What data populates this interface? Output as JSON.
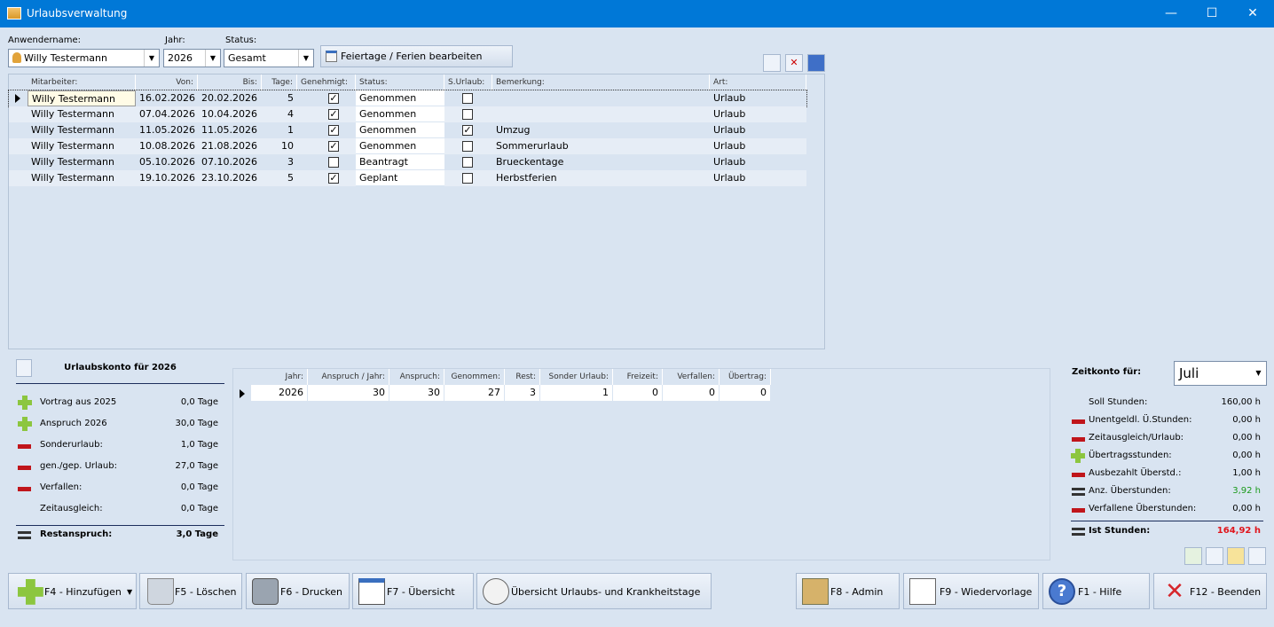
{
  "window": {
    "title": "Urlaubsverwaltung",
    "min": "—",
    "max": "☐",
    "close": "✕"
  },
  "filters": {
    "user_label": "Anwendername:",
    "user_value": "Willy Testermann",
    "year_label": "Jahr:",
    "year_value": "2026",
    "status_label": "Status:",
    "status_value": "Gesamt",
    "holiday_button": "Feiertage / Ferien bearbeiten"
  },
  "grid": {
    "headers": [
      "Mitarbeiter:",
      "Von:",
      "Bis:",
      "Tage:",
      "Genehmigt:",
      "Status:",
      "S.Urlaub:",
      "Bemerkung:",
      "Art:"
    ],
    "rows": [
      {
        "name": "Willy Testermann",
        "von": "16.02.2026",
        "bis": "20.02.2026",
        "tage": "5",
        "gen": true,
        "status": "Genommen",
        "surl": false,
        "bem": "",
        "art": "Urlaub"
      },
      {
        "name": "Willy Testermann",
        "von": "07.04.2026",
        "bis": "10.04.2026",
        "tage": "4",
        "gen": true,
        "status": "Genommen",
        "surl": false,
        "bem": "",
        "art": "Urlaub"
      },
      {
        "name": "Willy Testermann",
        "von": "11.05.2026",
        "bis": "11.05.2026",
        "tage": "1",
        "gen": true,
        "status": "Genommen",
        "surl": true,
        "bem": "Umzug",
        "art": "Urlaub"
      },
      {
        "name": "Willy Testermann",
        "von": "10.08.2026",
        "bis": "21.08.2026",
        "tage": "10",
        "gen": true,
        "status": "Genommen",
        "surl": false,
        "bem": "Sommerurlaub",
        "art": "Urlaub"
      },
      {
        "name": "Willy Testermann",
        "von": "05.10.2026",
        "bis": "07.10.2026",
        "tage": "3",
        "gen": false,
        "status": "Beantragt",
        "surl": false,
        "bem": "Brueckentage",
        "art": "Urlaub"
      },
      {
        "name": "Willy Testermann",
        "von": "19.10.2026",
        "bis": "23.10.2026",
        "tage": "5",
        "gen": true,
        "status": "Geplant",
        "surl": false,
        "bem": "Herbstferien",
        "art": "Urlaub"
      }
    ]
  },
  "konto": {
    "title": "Urlaubskonto für 2026",
    "rows": [
      {
        "label": "Vortrag aus 2025",
        "value": "0,0 Tage",
        "icon": "plus"
      },
      {
        "label": "Anspruch 2026",
        "value": "30,0 Tage",
        "icon": "plus"
      },
      {
        "label": "Sonderurlaub:",
        "value": "1,0 Tage",
        "icon": "minus"
      },
      {
        "label": "gen./gep. Urlaub:",
        "value": "27,0 Tage",
        "icon": "minus"
      },
      {
        "label": "Verfallen:",
        "value": "0,0 Tage",
        "icon": "minus"
      },
      {
        "label": "Zeitausgleich:",
        "value": "0,0 Tage",
        "icon": "none"
      }
    ],
    "total_label": "Restanspruch:",
    "total_value": "3,0 Tage"
  },
  "summary": {
    "headers": [
      "Jahr:",
      "Anspruch / Jahr:",
      "Anspruch:",
      "Genommen:",
      "Rest:",
      "Sonder Urlaub:",
      "Freizeit:",
      "Verfallen:",
      "Übertrag:"
    ],
    "row": [
      "2026",
      "30",
      "30",
      "27",
      "3",
      "1",
      "0",
      "0",
      "0"
    ]
  },
  "zeitkonto": {
    "label": "Zeitkonto für:",
    "month": "Juli",
    "rows": [
      {
        "label": "Soll Stunden:",
        "value": "160,00 h",
        "icon": "none",
        "color": "#000000"
      },
      {
        "label": "Unentgeldl. Ü.Stunden:",
        "value": "0,00 h",
        "icon": "minus",
        "color": "#000000"
      },
      {
        "label": "Zeitausgleich/Urlaub:",
        "value": "0,00 h",
        "icon": "minus",
        "color": "#000000"
      },
      {
        "label": "Übertragsstunden:",
        "value": "0,00 h",
        "icon": "plus",
        "color": "#000000"
      },
      {
        "label": "Ausbezahlt Überstd.:",
        "value": "1,00 h",
        "icon": "minus",
        "color": "#000000"
      },
      {
        "label": "Anz. Überstunden:",
        "value": "3,92 h",
        "icon": "eq",
        "color": "#1a9a1a"
      },
      {
        "label": "Verfallene Überstunden:",
        "value": "0,00 h",
        "icon": "minus",
        "color": "#000000"
      }
    ],
    "total_label": "Ist Stunden:",
    "total_value": "164,92 h",
    "total_color": "#e0141b"
  },
  "footer": {
    "add": "F4 - Hinzufügen",
    "delete": "F5 - Löschen",
    "print": "F6 - Drucken",
    "overview": "F7 - Übersicht",
    "overview_sick": "Übersicht Urlaubs- und Krankheitstage",
    "admin": "F8 - Admin",
    "resubmit": "F9 - Wiedervorlage",
    "help": "F1 - Hilfe",
    "quit": "F12 - Beenden"
  }
}
